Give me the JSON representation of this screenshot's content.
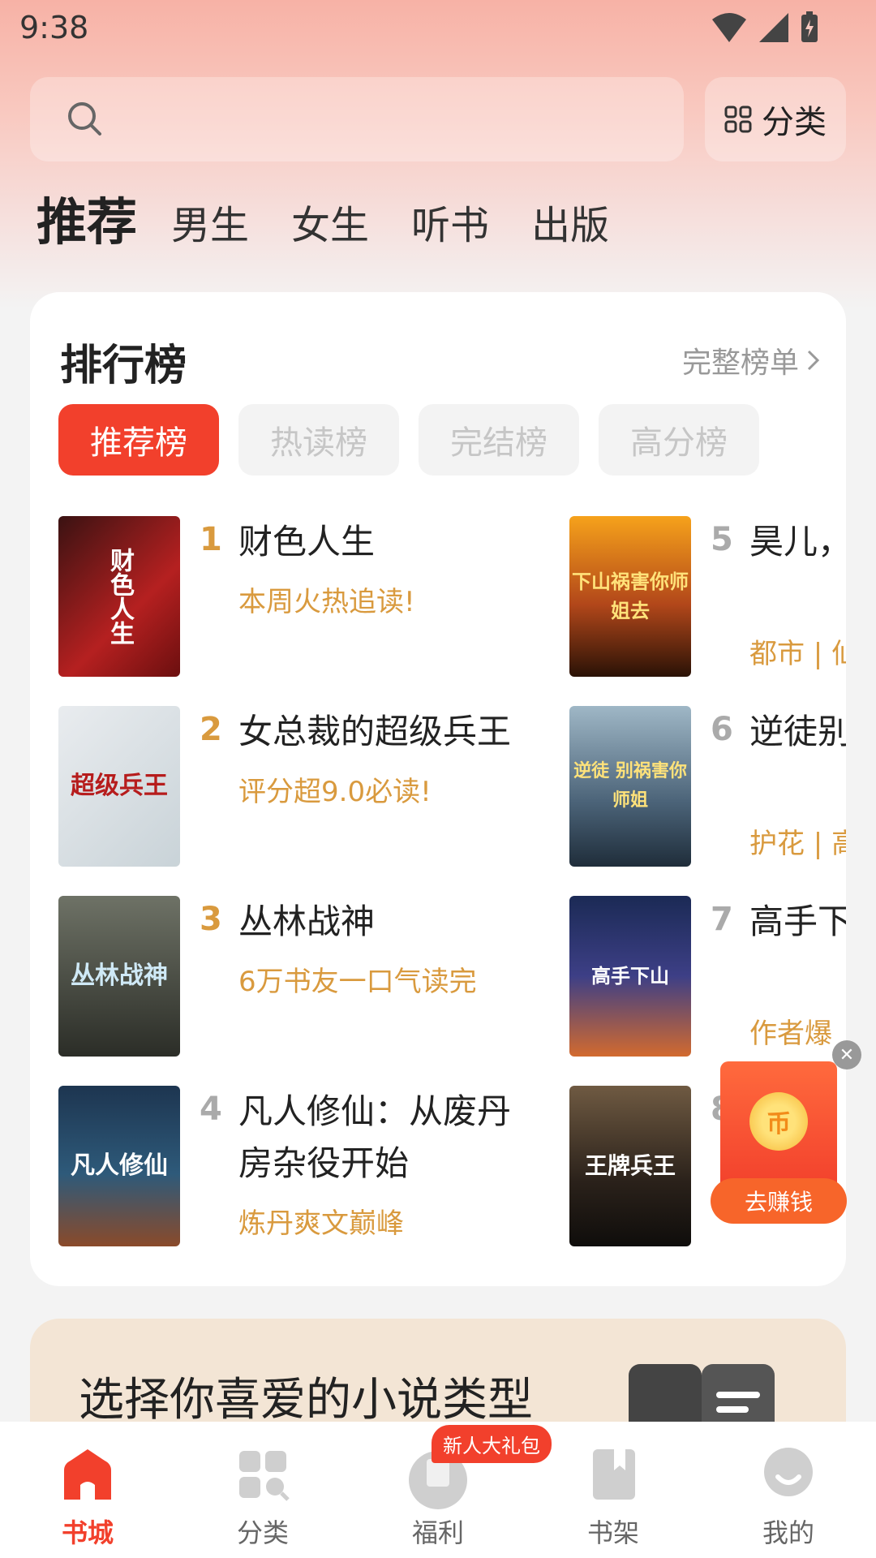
{
  "status": {
    "time": "9:38"
  },
  "search": {
    "placeholder": ""
  },
  "header": {
    "category_label": "分类"
  },
  "top_tabs": [
    {
      "label": "推荐"
    },
    {
      "label": "男生"
    },
    {
      "label": "女生"
    },
    {
      "label": "听书"
    },
    {
      "label": "出版"
    }
  ],
  "ranking": {
    "title": "排行榜",
    "more_label": "完整榜单",
    "chips": [
      {
        "label": "推荐榜"
      },
      {
        "label": "热读榜"
      },
      {
        "label": "完结榜"
      },
      {
        "label": "高分榜"
      }
    ],
    "books_left": [
      {
        "rank": "1",
        "title": "财色人生",
        "tag": "本周火热追读!",
        "cover_text": "财色人生"
      },
      {
        "rank": "2",
        "title": "女总裁的超级兵王",
        "tag": "评分超9.0必读!",
        "cover_text": "超级兵王"
      },
      {
        "rank": "3",
        "title": "丛林战神",
        "tag": "6万书友一口气读完",
        "cover_text": "丛林战神"
      },
      {
        "rank": "4",
        "title": "凡人修仙：从废丹房杂役开始",
        "tag": "炼丹爽文巅峰",
        "cover_text": "凡人修仙"
      }
    ],
    "books_right": [
      {
        "rank": "5",
        "title": "昊儿，师姐去",
        "tag": "都市 | 仙",
        "cover_text": "下山祸害你师姐去"
      },
      {
        "rank": "6",
        "title": "逆徒别姐，下",
        "tag": "护花 | 高",
        "cover_text": "逆徒 别祸害你师姐"
      },
      {
        "rank": "7",
        "title": "高手下通天，",
        "tag": "作者爆",
        "cover_text": "高手下山"
      },
      {
        "rank": "8",
        "title": "",
        "tag": "",
        "cover_text": "王牌兵王"
      }
    ]
  },
  "earn": {
    "button_label": "去赚钱",
    "coin_symbol": "币"
  },
  "genre": {
    "title": "选择你喜爱的小说类型"
  },
  "bottom_nav": [
    {
      "label": "书城"
    },
    {
      "label": "分类"
    },
    {
      "label": "福利"
    },
    {
      "label": "书架"
    },
    {
      "label": "我的"
    }
  ],
  "gift_badge": "新人大礼包",
  "colors": {
    "accent": "#f2402c",
    "tag": "#d99a3e"
  }
}
